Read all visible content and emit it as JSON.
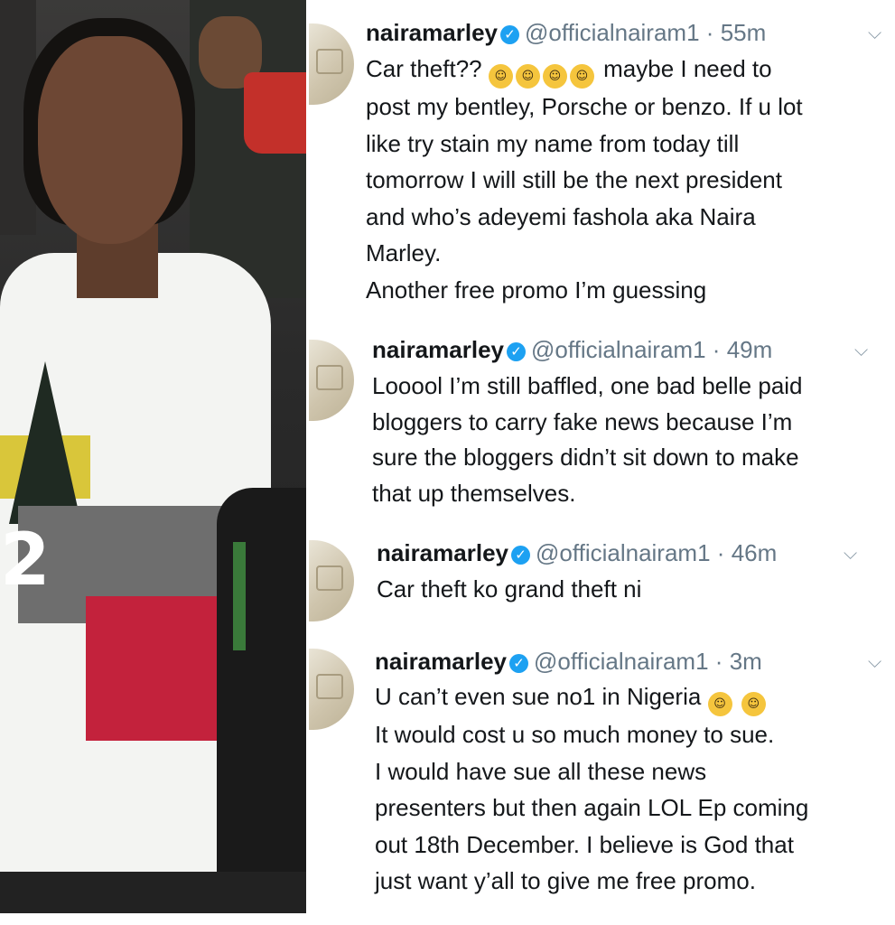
{
  "photo": {
    "shirt_number_fragment": "2"
  },
  "tweets": [
    {
      "name": "nairamarley",
      "handle": "@officialnairam1",
      "separator": "·",
      "time": "55m",
      "lines": [
        {
          "text": "Car theft??",
          "emoji_count": 4,
          "after": "maybe I need to"
        },
        {
          "text": "post my bentley, Porsche or benzo. If u lot"
        },
        {
          "text": "like try stain my name from today till"
        },
        {
          "text": "tomorrow I will still be the next president"
        },
        {
          "text": "and who’s adeyemi fashola aka Naira"
        },
        {
          "text": "Marley."
        },
        {
          "text": "Another free promo I’m guessing"
        }
      ]
    },
    {
      "name": "nairamarley",
      "handle": "@officialnairam1",
      "separator": "·",
      "time": "49m",
      "lines": [
        {
          "text": "Looool I’m still baffled, one bad belle paid"
        },
        {
          "text": "bloggers to carry fake news because I’m"
        },
        {
          "text": "sure the bloggers didn’t sit down to make"
        },
        {
          "text": "that up themselves."
        }
      ]
    },
    {
      "name": "nairamarley",
      "handle": "@officialnairam1",
      "separator": "·",
      "time": "46m",
      "lines": [
        {
          "text": "Car theft ko grand theft ni"
        }
      ]
    },
    {
      "name": "nairamarley",
      "handle": "@officialnairam1",
      "separator": "·",
      "time": "3m",
      "lines": [
        {
          "text": "U can’t even sue no1 in Nigeria",
          "emoji_count": 2
        },
        {
          "text": "It would cost u so much money to sue."
        },
        {
          "text": "I would have sue all these news"
        },
        {
          "text": "presenters but then again LOL Ep coming"
        },
        {
          "text": "out 18th December. I believe is God that"
        },
        {
          "text": "just want y’all to give me free promo."
        }
      ]
    }
  ],
  "icons": {
    "emoji": "face-with-tears-of-joy-icon",
    "verified": "verified-badge-icon",
    "menu": "chevron-down-icon"
  },
  "colors": {
    "verified": "#1da1f2",
    "text": "#14171a",
    "muted": "#657786"
  }
}
